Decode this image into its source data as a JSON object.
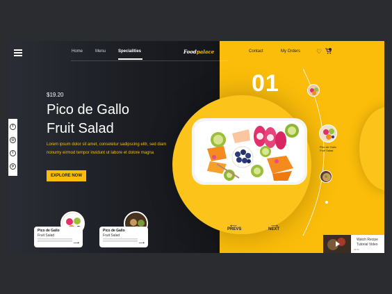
{
  "brand": {
    "logo_prefix": "Food",
    "logo_suffix": "palace"
  },
  "nav": {
    "home": "Home",
    "menu": "Menu",
    "specialities": "Specialities",
    "contact": "Contact",
    "orders": "My Orders"
  },
  "hero": {
    "price": "$19.20",
    "title_line1": "Pico de Gallo",
    "title_line2": "Fruit Salad",
    "description": "Lorem ipsum dolor sit amet, consetetur sadipscing elitr, sed diam nonumy eirmod tempor invidunt ut labore et dolore magna",
    "cta": "EXPLORE NOW"
  },
  "slider": {
    "number": "01",
    "prev": "PREVS",
    "next": "NEXT"
  },
  "cards": [
    {
      "name": "Pico de Gallo",
      "subtitle": "Fruit Salad"
    },
    {
      "name": "Pico de Gallo",
      "subtitle": "Fruit Salad"
    }
  ],
  "side_thumbs": [
    {
      "name": "Pico de Gallo",
      "subtitle": "Fruit Salad"
    }
  ],
  "watch": {
    "title_line1": "Watch Recipe",
    "title_line2": "Tutorial Video",
    "duration": "02:04"
  },
  "social": [
    "facebook-icon",
    "instagram-icon",
    "twitter-icon",
    "pinterest-icon"
  ],
  "colors": {
    "accent": "#fbbd0a",
    "dark": "#1b1d23"
  }
}
